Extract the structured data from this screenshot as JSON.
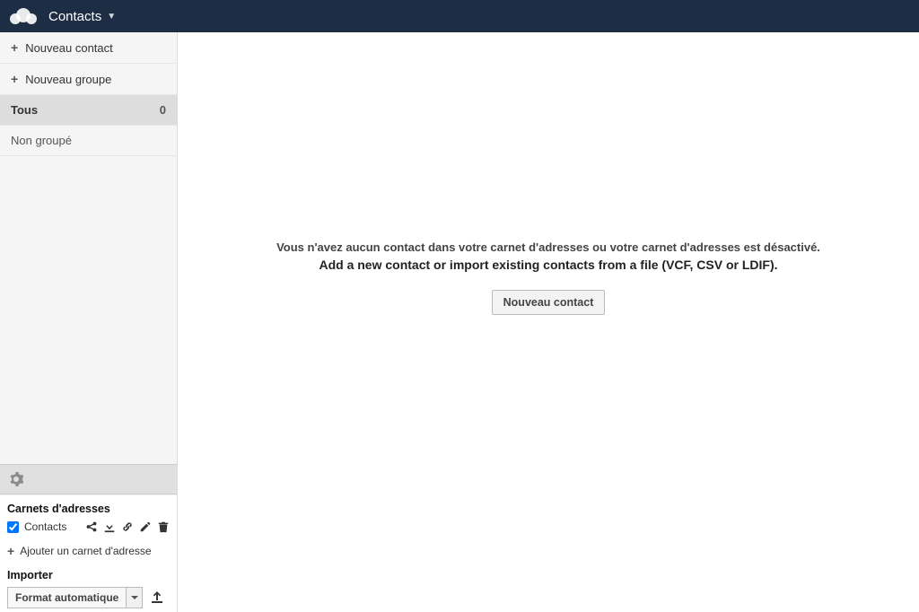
{
  "header": {
    "app_title": "Contacts"
  },
  "sidebar": {
    "new_contact": "Nouveau contact",
    "new_group": "Nouveau groupe",
    "groups": [
      {
        "label": "Tous",
        "count": "0",
        "active": true
      },
      {
        "label": "Non groupé",
        "count": "",
        "active": false
      }
    ]
  },
  "settings": {
    "addressbooks_heading": "Carnets d'adresses",
    "addressbook_name": "Contacts",
    "add_addressbook": "Ajouter un carnet d'adresse",
    "import_heading": "Importer",
    "import_format": "Format automatique"
  },
  "main": {
    "empty_line1": "Vous n'avez aucun contact dans votre carnet d'adresses ou votre carnet d'adresses est désactivé.",
    "empty_line2": "Add a new contact or import existing contacts from a file (VCF, CSV or LDIF).",
    "new_contact_button": "Nouveau contact"
  }
}
